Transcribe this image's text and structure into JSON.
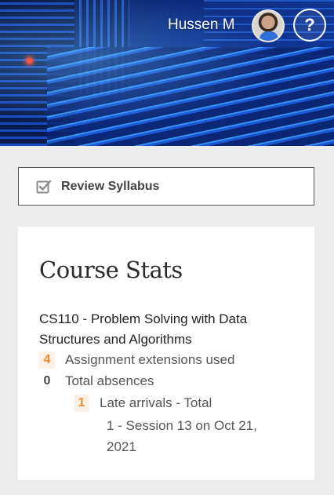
{
  "header": {
    "user_name": "Hussen M",
    "help_label": "?"
  },
  "actions": {
    "review_syllabus_label": "Review Syllabus"
  },
  "course_stats": {
    "title": "Course Stats",
    "course_name": "CS110 - Problem Solving with Data Structures and Algorithms",
    "stats": [
      {
        "count": "4",
        "label": "Assignment extensions used"
      },
      {
        "count": "0",
        "label": "Total absences"
      },
      {
        "count": "1",
        "label": "Late arrivals - Total"
      }
    ],
    "late_detail": "1 - Session 13 on Oct 21, 2021"
  },
  "colors": {
    "accent_orange": "#f08a2a",
    "badge_bg": "#fdf0e6",
    "page_bg": "#ececec"
  },
  "icons": {
    "avatar": "user-avatar",
    "help": "help-icon",
    "syllabus": "checkbox-icon"
  }
}
